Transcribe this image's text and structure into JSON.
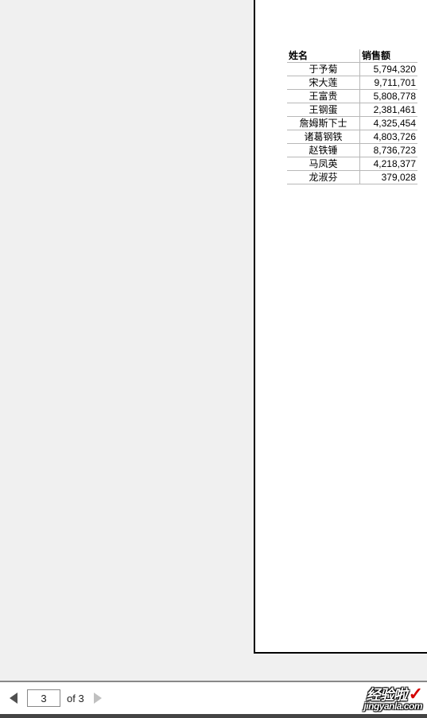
{
  "chart_data": {
    "type": "table",
    "columns": [
      "姓名",
      "销售额"
    ],
    "rows": [
      {
        "name": "于予菊",
        "sales": "5,794,320"
      },
      {
        "name": "宋大莲",
        "sales": "9,711,701"
      },
      {
        "name": "王富贵",
        "sales": "5,808,778"
      },
      {
        "name": "王钢蛋",
        "sales": "2,381,461"
      },
      {
        "name": "詹姆斯下士",
        "sales": "4,325,454"
      },
      {
        "name": "诸葛钢铁",
        "sales": "4,803,726"
      },
      {
        "name": "赵铁锤",
        "sales": "8,736,723"
      },
      {
        "name": "马凤英",
        "sales": "4,218,377"
      },
      {
        "name": "龙淑芬",
        "sales": "379,028"
      }
    ]
  },
  "header": {
    "name": "姓名",
    "sales": "销售额"
  },
  "rows": [
    {
      "name": "于予菊",
      "sales": "5,794,320"
    },
    {
      "name": "宋大莲",
      "sales": "9,711,701"
    },
    {
      "name": "王富贵",
      "sales": "5,808,778"
    },
    {
      "name": "王钢蛋",
      "sales": "2,381,461"
    },
    {
      "name": "詹姆斯下士",
      "sales": "4,325,454"
    },
    {
      "name": "诸葛钢铁",
      "sales": "4,803,726"
    },
    {
      "name": "赵铁锤",
      "sales": "8,736,723"
    },
    {
      "name": "马凤英",
      "sales": "4,218,377"
    },
    {
      "name": "龙淑芬",
      "sales": "379,028"
    }
  ],
  "pager": {
    "current": "3",
    "of_label": "of 3"
  },
  "watermark": {
    "top": "经验啦",
    "check": "✓",
    "bottom": "jingyanla.com"
  }
}
